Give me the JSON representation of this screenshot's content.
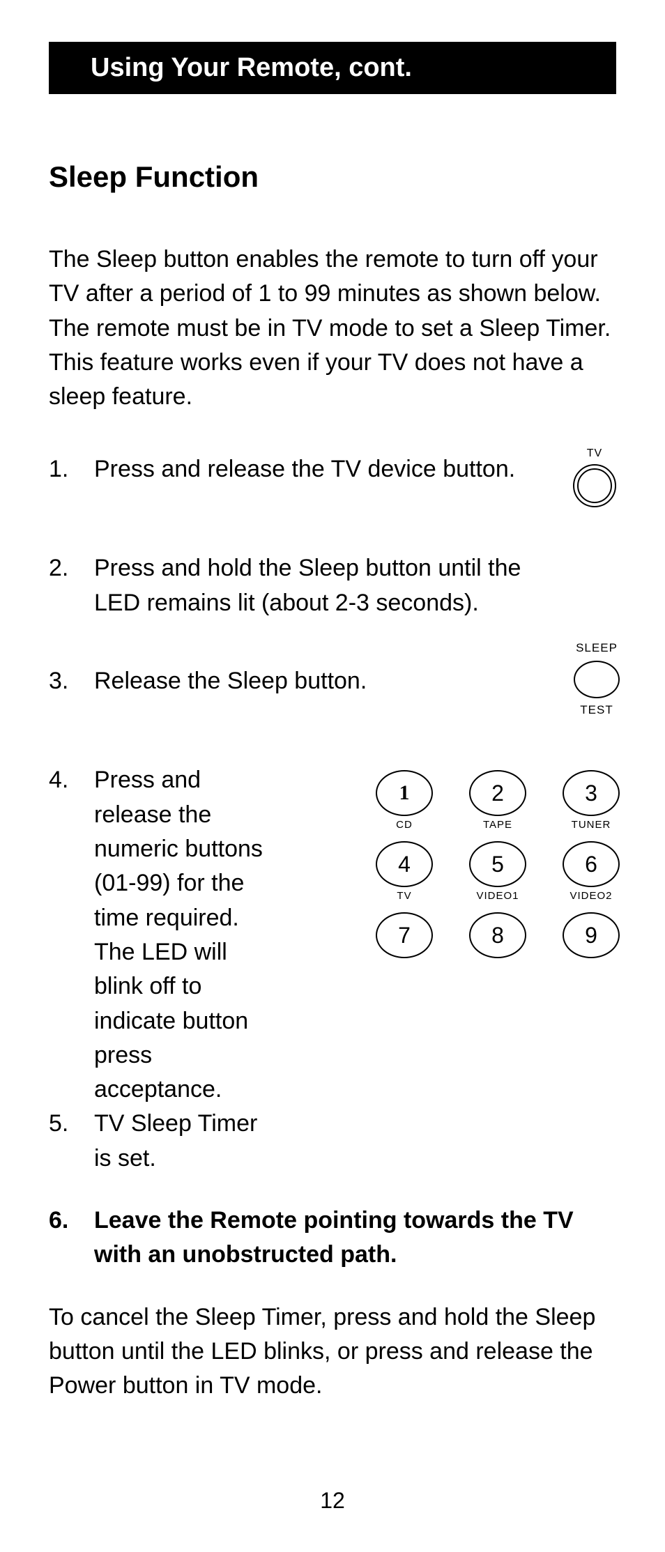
{
  "header": "Using Your Remote, cont.",
  "section_title": "Sleep Function",
  "intro": "The Sleep button enables the remote to turn off your TV after a period of 1 to 99 minutes as shown below. The remote must be in TV mode to set a Sleep Timer. This feature works even if your TV does not have a sleep feature.",
  "step1": "Press and release the TV device button.",
  "step2": "Press and hold the Sleep button until the LED remains lit (about 2-3 seconds).",
  "step3": "Release the Sleep button.",
  "step4": "Press and release the numeric buttons (01-99) for the time required. The LED will blink off to indicate button press acceptance.",
  "step5": "TV Sleep Timer is set.",
  "step6": "Leave the Remote pointing towards the TV with an unobstructed path.",
  "cancel": "To cancel the Sleep Timer, press and hold the Sleep button until the LED blinks, or press and release the Power button in TV mode.",
  "page_number": "12",
  "tv_label": "TV",
  "sleep_top": "SLEEP",
  "sleep_bottom": "TEST",
  "pad": {
    "b1": "1",
    "b2": "2",
    "b3": "3",
    "b4": "4",
    "b5": "5",
    "b6": "6",
    "b7": "7",
    "b8": "8",
    "b9": "9",
    "s1": "CD",
    "s2": "TAPE",
    "s3": "TUNER",
    "s4": "TV",
    "s5": "VIDEO1",
    "s6": "VIDEO2"
  }
}
